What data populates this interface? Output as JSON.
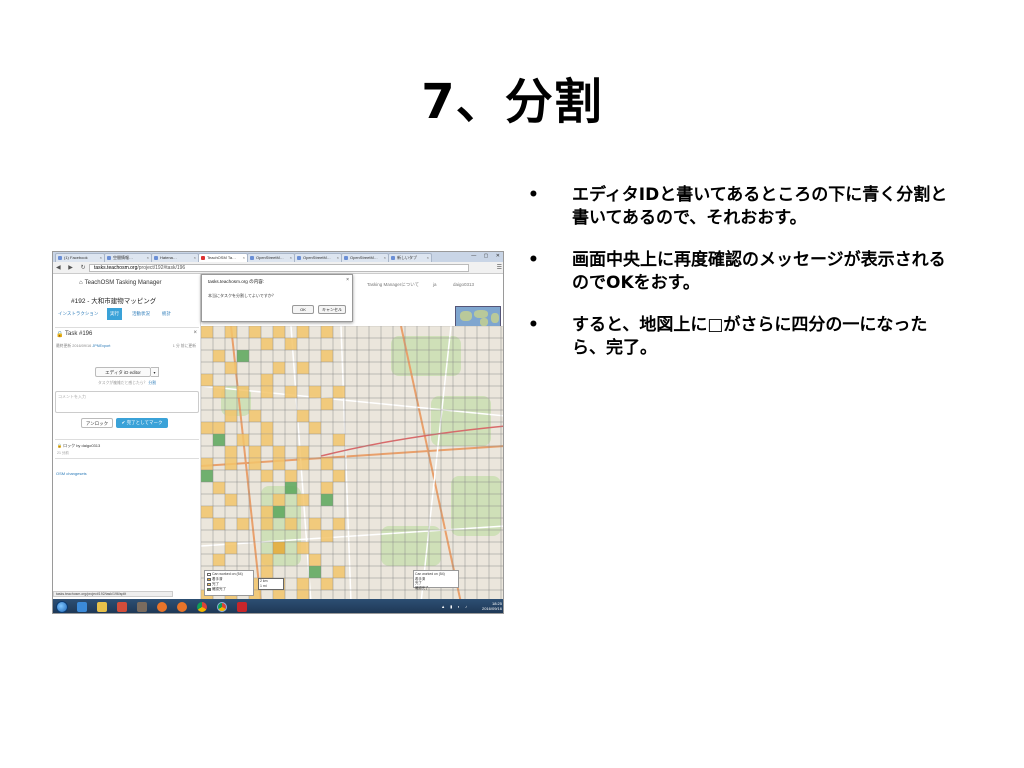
{
  "slide": {
    "title": "7、分割",
    "bullets": [
      "エディタIDと書いてあるところの下に青く分割と書いてあるので、それおおす。",
      "画面中央上に再度確認のメッセージが表示されるのでOKをおす。",
      "すると、地図上に□がさらに四分の一になったら、完了。"
    ],
    "bullet_symbol": "•"
  },
  "browser": {
    "tabs": [
      "(1) Facebook",
      "空間情報…",
      "Hatena…",
      "TeachOSM Ta…",
      "OpenStreetM…",
      "OpenStreetM…",
      "OpenStreetM…",
      "新しいタブ"
    ],
    "active_tab": 3,
    "url_host": "tasks.teachosm.org",
    "url_path": "/project/192#task/196",
    "status_url": "tasks.teachosm.org/project/192/task/196/split"
  },
  "app": {
    "brand": "TeachOSM Tasking Manager",
    "project_title": "#192 - 大和市建物マッピング",
    "nav_tabs": [
      "インストラクション",
      "実行",
      "活動状況",
      "統計"
    ],
    "active_nav": 1,
    "task_label": "Task #196",
    "meta_left": "最終更新 2016/09/16",
    "meta_link": "JPNExport",
    "meta_right": "1 分 前に更新",
    "editor_button": "エディタ iD editor",
    "split_text": "タスクが複雑だと感じたら？",
    "split_link": "分割",
    "comment_placeholder": "コメントを入力",
    "unlock_button": "アンロック",
    "done_button": "完了としてマーク",
    "history_line": "ロック by daigo0313",
    "history_sub": "21 分前",
    "osm_changesets": "OSM changesets",
    "top_menu": [
      "Tasking Managerについて",
      "ja",
      "daigo0313"
    ]
  },
  "dialog": {
    "title": "tasks.teachosm.org の内容:",
    "message": "本当にタスクを分割してよいですか？",
    "ok": "OK",
    "cancel": "キャンセル",
    "close": "×"
  },
  "map": {
    "legend": [
      "Can worked on (54)",
      "着手済",
      "完了",
      "確認完了"
    ],
    "scale": [
      "2 km",
      "1 mi"
    ],
    "right_legend": [
      "Can worked on (54)",
      "着手済",
      "完了",
      "確認完了"
    ],
    "colors": {
      "todo": "#cfcfcf",
      "locked": "#e6a935",
      "done": "#f2c46b",
      "validated": "#5aa65a"
    }
  },
  "taskbar": {
    "time": "18:25",
    "date": "2016/09/16"
  }
}
